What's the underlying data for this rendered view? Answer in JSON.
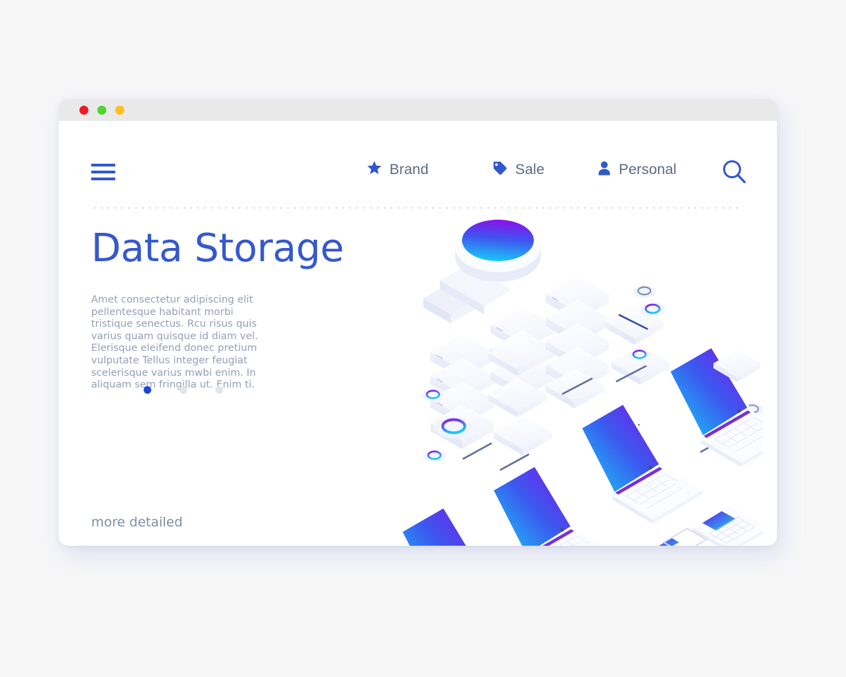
{
  "window": {
    "traffic_lights": [
      {
        "name": "close",
        "color": "#ed1b24"
      },
      {
        "name": "minimize",
        "color": "#4ed42a"
      },
      {
        "name": "maximize",
        "color": "#fcc01b"
      }
    ]
  },
  "nav": {
    "menu_icon": "hamburger-icon",
    "items": [
      {
        "icon": "star-icon",
        "label": "Brand"
      },
      {
        "icon": "tag-icon",
        "label": "Sale"
      },
      {
        "icon": "person-icon",
        "label": "Personal"
      }
    ],
    "search_icon": "search-icon"
  },
  "hero": {
    "title": "Data Storage",
    "paragraph": "Amet consectetur adipiscing elit pellentesque habitant morbi tristique senectus. Rcu risus quis varius quam quisque id diam vel. Elerisque eleifend donec pretium vulputate Tellus integer feugiat scelerisque varius mwbi enim. In aliquam sem fringilla ut. Enim ti.",
    "cta": "more detailed",
    "carousel": {
      "count": 3,
      "active_index": 0
    }
  },
  "colors": {
    "accent_blue": "#3558cf",
    "nav_text": "#5d6b84",
    "body_text": "#93a0b5",
    "gradient_start": "#7b16e8",
    "gradient_mid": "#3a5bf0",
    "gradient_end": "#16d0f5",
    "page_background": "#f7f7f8",
    "card_background": "#ffffff",
    "titlebar_background": "#e9e9ea"
  },
  "illustration": {
    "name": "isometric-data-storage-illustration",
    "elements": [
      "magnifier-with-gradient-disc",
      "server-stack-left",
      "server-stack-middle",
      "server-stack-right",
      "laptop-top-right",
      "laptop-middle",
      "laptop-center",
      "laptop-bottom-left",
      "smartphone",
      "keyboard",
      "document-sheet-with-chart",
      "gear-rings",
      "floating-cards",
      "connector-lines"
    ]
  }
}
